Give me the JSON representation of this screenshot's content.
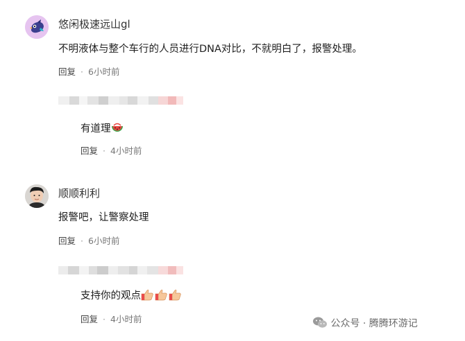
{
  "comments": [
    {
      "username": "悠闲极速远山gl",
      "text": "不明液体与整个车行的人员进行DNA对比，不就明白了，报警处理。",
      "reply_label": "回复",
      "separator": "·",
      "time": "6小时前",
      "reply": {
        "text": "有道理",
        "emoji": "watermelon-icon",
        "reply_label": "回复",
        "separator": "·",
        "time": "4小时前"
      }
    },
    {
      "username": "顺顺利利",
      "text": "报警吧，让警察处理",
      "reply_label": "回复",
      "separator": "·",
      "time": "6小时前",
      "reply": {
        "text": "支持你的观点",
        "emoji": "thumbs-up-icon",
        "reply_label": "回复",
        "separator": "·",
        "time": "4小时前"
      }
    }
  ],
  "watermark": {
    "text": "公众号 · 腾腾环游记",
    "icon": "wechat-icon"
  },
  "colors": {
    "text": "#1f1f1f",
    "meta": "#777777",
    "pixelated_name": [
      "#e9e9e9",
      "#f4f4f4",
      "#d4d4d4",
      "#ececec",
      "#f3c3c3"
    ]
  }
}
